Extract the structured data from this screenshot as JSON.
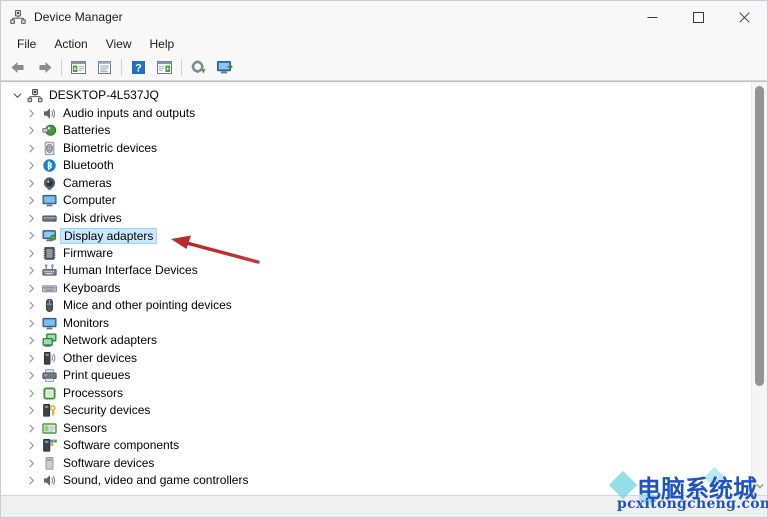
{
  "window": {
    "title": "Device Manager",
    "app_icon": "device-manager-icon"
  },
  "caption": {
    "minimize": "—",
    "maximize": "□",
    "close": "✕"
  },
  "menubar": {
    "items": [
      {
        "label": "File",
        "name": "menu-file"
      },
      {
        "label": "Action",
        "name": "menu-action"
      },
      {
        "label": "View",
        "name": "menu-view"
      },
      {
        "label": "Help",
        "name": "menu-help"
      }
    ]
  },
  "toolbar": {
    "buttons": [
      {
        "name": "back-button",
        "icon": "back-arrow-icon"
      },
      {
        "name": "forward-button",
        "icon": "forward-arrow-icon"
      },
      {
        "name": "separator-1",
        "icon": "separator"
      },
      {
        "name": "show-hide-console-tree-button",
        "icon": "console-tree-icon"
      },
      {
        "name": "properties-button",
        "icon": "properties-icon"
      },
      {
        "name": "separator-2",
        "icon": "separator"
      },
      {
        "name": "help-button",
        "icon": "help-question-icon"
      },
      {
        "name": "show-hide-action-pane-button",
        "icon": "action-pane-icon"
      },
      {
        "name": "separator-3",
        "icon": "separator"
      },
      {
        "name": "update-driver-button",
        "icon": "update-driver-icon"
      },
      {
        "name": "scan-hardware-changes-button",
        "icon": "scan-hardware-icon"
      }
    ]
  },
  "tree": {
    "root": {
      "label": "DESKTOP-4L537JQ",
      "icon": "computer-node-icon",
      "expanded": true
    },
    "items": [
      {
        "label": "Audio inputs and outputs",
        "icon": "speaker-icon",
        "selected": false
      },
      {
        "label": "Batteries",
        "icon": "battery-icon",
        "selected": false
      },
      {
        "label": "Biometric devices",
        "icon": "fingerprint-icon",
        "selected": false
      },
      {
        "label": "Bluetooth",
        "icon": "bluetooth-icon",
        "selected": false
      },
      {
        "label": "Cameras",
        "icon": "camera-icon",
        "selected": false
      },
      {
        "label": "Computer",
        "icon": "monitor-icon",
        "selected": false
      },
      {
        "label": "Disk drives",
        "icon": "disk-drive-icon",
        "selected": false
      },
      {
        "label": "Display adapters",
        "icon": "display-adapter-icon",
        "selected": true
      },
      {
        "label": "Firmware",
        "icon": "firmware-icon",
        "selected": false
      },
      {
        "label": "Human Interface Devices",
        "icon": "hid-icon",
        "selected": false
      },
      {
        "label": "Keyboards",
        "icon": "keyboard-icon",
        "selected": false
      },
      {
        "label": "Mice and other pointing devices",
        "icon": "mouse-icon",
        "selected": false
      },
      {
        "label": "Monitors",
        "icon": "monitor-blue-icon",
        "selected": false
      },
      {
        "label": "Network adapters",
        "icon": "network-adapter-icon",
        "selected": false
      },
      {
        "label": "Other devices",
        "icon": "other-device-icon",
        "selected": false
      },
      {
        "label": "Print queues",
        "icon": "printer-icon",
        "selected": false
      },
      {
        "label": "Processors",
        "icon": "processor-icon",
        "selected": false
      },
      {
        "label": "Security devices",
        "icon": "security-device-icon",
        "selected": false
      },
      {
        "label": "Sensors",
        "icon": "sensor-icon",
        "selected": false
      },
      {
        "label": "Software components",
        "icon": "software-component-icon",
        "selected": false
      },
      {
        "label": "Software devices",
        "icon": "software-device-icon",
        "selected": false
      },
      {
        "label": "Sound, video and game controllers",
        "icon": "sound-video-icon",
        "selected": false
      }
    ]
  },
  "statusbar": {
    "text": ""
  },
  "annotation": {
    "arrow_color": "#c0272d",
    "name": "red-arrow-pointing-to-display-adapters"
  },
  "watermark": {
    "chinese": "电脑系统城",
    "domain": "pcxitongcheng.com",
    "color": "#1f53c4",
    "accent_color": "#6fd3e0"
  },
  "colors": {
    "selection_fill": "#cce8ff",
    "selection_border": "#99d1ff",
    "window_bg": "#f8f8f8",
    "content_bg": "#ffffff"
  }
}
